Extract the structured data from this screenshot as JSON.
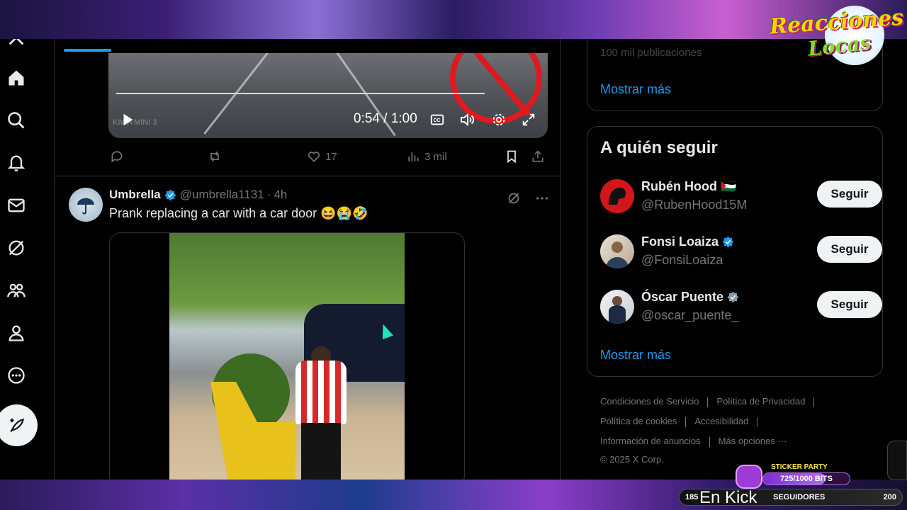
{
  "overlay": {
    "logo_line1": "Reacciones",
    "logo_line2": "Locas",
    "sticker_title": "STICKER PARTY",
    "sticker_value": "725/1000 BITS",
    "sticker_progress": 0.725,
    "followers_label": "SEGUIDORES",
    "followers_current": "185",
    "followers_goal": "200",
    "kick_text": "En Kick"
  },
  "nav": [
    "x-logo-icon",
    "home-icon",
    "search-icon",
    "bell-icon",
    "mail-icon",
    "grok-icon",
    "communities-icon",
    "profile-icon",
    "more-icon"
  ],
  "video": {
    "time": "0:54 / 1:00",
    "watermark": "KIWA MINI 3",
    "progress": 0.9
  },
  "tweet_actions": {
    "likes": "17",
    "views": "3 mil"
  },
  "post": {
    "name": "Umbrella",
    "handle": "@umbrella1131",
    "dot": "·",
    "time": "4h",
    "text": "Prank replacing a car with a car door 😆😭🤣"
  },
  "sidebar_right": {
    "faded_text": "100 mil publicaciones",
    "show_more_top": "Mostrar más",
    "who_to_follow_title": "A quién seguir",
    "follow_button": "Seguir",
    "suggestions": [
      {
        "name": "Rubén Hood 🇵🇸",
        "handle": "@RubenHood15M",
        "verified": false
      },
      {
        "name": "Fonsi Loaiza",
        "handle": "@FonsiLoaiza",
        "verified": true
      },
      {
        "name": "Óscar Puente",
        "handle": "@oscar_puente_",
        "verified": true
      }
    ],
    "show_more_bottom": "Mostrar más",
    "footer": {
      "terms": "Condiciones de Servicio",
      "privacy": "Política de Privacidad",
      "cookies": "Política de cookies",
      "accessibility": "Accesibilidad",
      "ads_info": "Información de anuncios",
      "more": "Más opciones ···",
      "copyright": "© 2025 X Corp."
    }
  },
  "colors": {
    "accent": "#1d9bf0",
    "background": "#000000",
    "border": "#2f3336",
    "muted": "#71767b"
  }
}
